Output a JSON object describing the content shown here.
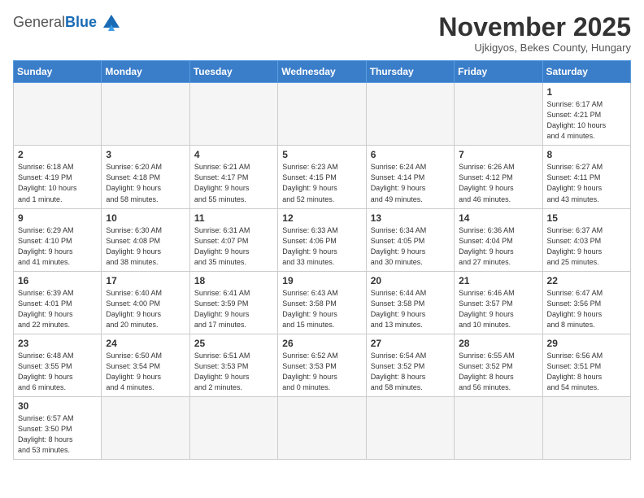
{
  "logo": {
    "general": "General",
    "blue": "Blue"
  },
  "title": "November 2025",
  "subtitle": "Ujkigyos, Bekes County, Hungary",
  "headers": [
    "Sunday",
    "Monday",
    "Tuesday",
    "Wednesday",
    "Thursday",
    "Friday",
    "Saturday"
  ],
  "weeks": [
    [
      {
        "day": "",
        "info": "",
        "empty": true
      },
      {
        "day": "",
        "info": "",
        "empty": true
      },
      {
        "day": "",
        "info": "",
        "empty": true
      },
      {
        "day": "",
        "info": "",
        "empty": true
      },
      {
        "day": "",
        "info": "",
        "empty": true
      },
      {
        "day": "",
        "info": "",
        "empty": true
      },
      {
        "day": "1",
        "info": "Sunrise: 6:17 AM\nSunset: 4:21 PM\nDaylight: 10 hours\nand 4 minutes."
      }
    ],
    [
      {
        "day": "2",
        "info": "Sunrise: 6:18 AM\nSunset: 4:19 PM\nDaylight: 10 hours\nand 1 minute."
      },
      {
        "day": "3",
        "info": "Sunrise: 6:20 AM\nSunset: 4:18 PM\nDaylight: 9 hours\nand 58 minutes."
      },
      {
        "day": "4",
        "info": "Sunrise: 6:21 AM\nSunset: 4:17 PM\nDaylight: 9 hours\nand 55 minutes."
      },
      {
        "day": "5",
        "info": "Sunrise: 6:23 AM\nSunset: 4:15 PM\nDaylight: 9 hours\nand 52 minutes."
      },
      {
        "day": "6",
        "info": "Sunrise: 6:24 AM\nSunset: 4:14 PM\nDaylight: 9 hours\nand 49 minutes."
      },
      {
        "day": "7",
        "info": "Sunrise: 6:26 AM\nSunset: 4:12 PM\nDaylight: 9 hours\nand 46 minutes."
      },
      {
        "day": "8",
        "info": "Sunrise: 6:27 AM\nSunset: 4:11 PM\nDaylight: 9 hours\nand 43 minutes."
      }
    ],
    [
      {
        "day": "9",
        "info": "Sunrise: 6:29 AM\nSunset: 4:10 PM\nDaylight: 9 hours\nand 41 minutes."
      },
      {
        "day": "10",
        "info": "Sunrise: 6:30 AM\nSunset: 4:08 PM\nDaylight: 9 hours\nand 38 minutes."
      },
      {
        "day": "11",
        "info": "Sunrise: 6:31 AM\nSunset: 4:07 PM\nDaylight: 9 hours\nand 35 minutes."
      },
      {
        "day": "12",
        "info": "Sunrise: 6:33 AM\nSunset: 4:06 PM\nDaylight: 9 hours\nand 33 minutes."
      },
      {
        "day": "13",
        "info": "Sunrise: 6:34 AM\nSunset: 4:05 PM\nDaylight: 9 hours\nand 30 minutes."
      },
      {
        "day": "14",
        "info": "Sunrise: 6:36 AM\nSunset: 4:04 PM\nDaylight: 9 hours\nand 27 minutes."
      },
      {
        "day": "15",
        "info": "Sunrise: 6:37 AM\nSunset: 4:03 PM\nDaylight: 9 hours\nand 25 minutes."
      }
    ],
    [
      {
        "day": "16",
        "info": "Sunrise: 6:39 AM\nSunset: 4:01 PM\nDaylight: 9 hours\nand 22 minutes."
      },
      {
        "day": "17",
        "info": "Sunrise: 6:40 AM\nSunset: 4:00 PM\nDaylight: 9 hours\nand 20 minutes."
      },
      {
        "day": "18",
        "info": "Sunrise: 6:41 AM\nSunset: 3:59 PM\nDaylight: 9 hours\nand 17 minutes."
      },
      {
        "day": "19",
        "info": "Sunrise: 6:43 AM\nSunset: 3:58 PM\nDaylight: 9 hours\nand 15 minutes."
      },
      {
        "day": "20",
        "info": "Sunrise: 6:44 AM\nSunset: 3:58 PM\nDaylight: 9 hours\nand 13 minutes."
      },
      {
        "day": "21",
        "info": "Sunrise: 6:46 AM\nSunset: 3:57 PM\nDaylight: 9 hours\nand 10 minutes."
      },
      {
        "day": "22",
        "info": "Sunrise: 6:47 AM\nSunset: 3:56 PM\nDaylight: 9 hours\nand 8 minutes."
      }
    ],
    [
      {
        "day": "23",
        "info": "Sunrise: 6:48 AM\nSunset: 3:55 PM\nDaylight: 9 hours\nand 6 minutes."
      },
      {
        "day": "24",
        "info": "Sunrise: 6:50 AM\nSunset: 3:54 PM\nDaylight: 9 hours\nand 4 minutes."
      },
      {
        "day": "25",
        "info": "Sunrise: 6:51 AM\nSunset: 3:53 PM\nDaylight: 9 hours\nand 2 minutes."
      },
      {
        "day": "26",
        "info": "Sunrise: 6:52 AM\nSunset: 3:53 PM\nDaylight: 9 hours\nand 0 minutes."
      },
      {
        "day": "27",
        "info": "Sunrise: 6:54 AM\nSunset: 3:52 PM\nDaylight: 8 hours\nand 58 minutes."
      },
      {
        "day": "28",
        "info": "Sunrise: 6:55 AM\nSunset: 3:52 PM\nDaylight: 8 hours\nand 56 minutes."
      },
      {
        "day": "29",
        "info": "Sunrise: 6:56 AM\nSunset: 3:51 PM\nDaylight: 8 hours\nand 54 minutes."
      }
    ],
    [
      {
        "day": "30",
        "info": "Sunrise: 6:57 AM\nSunset: 3:50 PM\nDaylight: 8 hours\nand 53 minutes."
      },
      {
        "day": "",
        "info": "",
        "empty": true
      },
      {
        "day": "",
        "info": "",
        "empty": true
      },
      {
        "day": "",
        "info": "",
        "empty": true
      },
      {
        "day": "",
        "info": "",
        "empty": true
      },
      {
        "day": "",
        "info": "",
        "empty": true
      },
      {
        "day": "",
        "info": "",
        "empty": true
      }
    ]
  ]
}
